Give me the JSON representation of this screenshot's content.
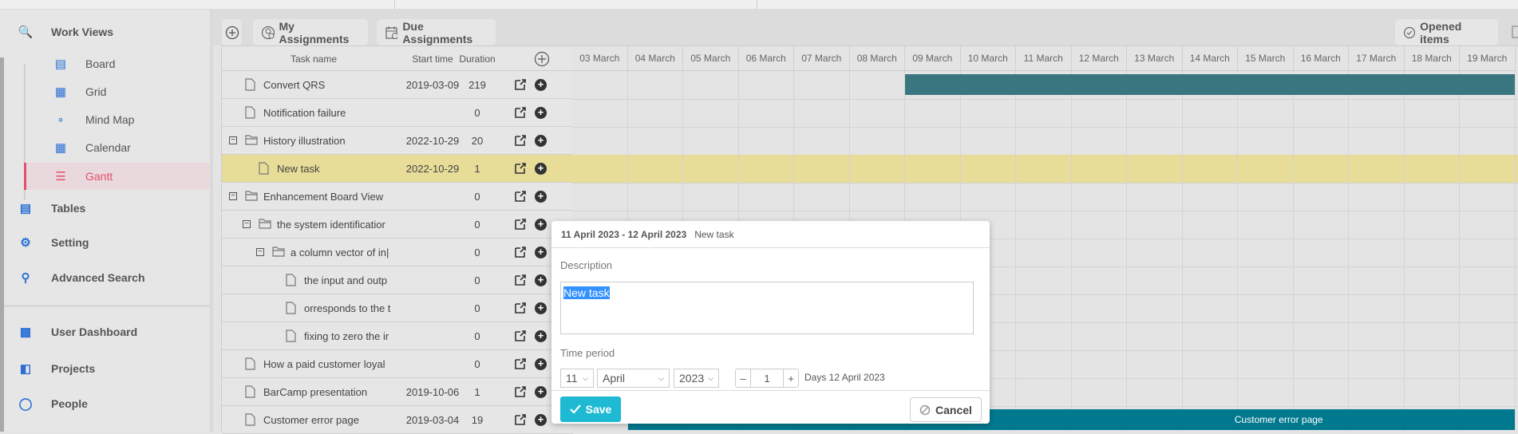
{
  "sidebar": {
    "work_views": "Work Views",
    "sub_items": [
      {
        "label": "Board",
        "icon": "board-icon"
      },
      {
        "label": "Grid",
        "icon": "grid-icon"
      },
      {
        "label": "Mind Map",
        "icon": "mind-map-icon"
      },
      {
        "label": "Calendar",
        "icon": "calendar-icon"
      },
      {
        "label": "Gantt",
        "icon": "gantt-icon",
        "active": true
      }
    ],
    "items": [
      {
        "label": "Tables",
        "icon": "table-icon"
      },
      {
        "label": "Setting",
        "icon": "gear-icon"
      },
      {
        "label": "Advanced Search",
        "icon": "search-icon"
      }
    ],
    "bottom_items": [
      {
        "label": "User Dashboard",
        "icon": "dashboard-icon"
      },
      {
        "label": "Projects",
        "icon": "book-icon"
      },
      {
        "label": "People",
        "icon": "person-icon"
      }
    ],
    "accent": "#e0506e",
    "icon_color": "#2b6fd6"
  },
  "toolbar": {
    "my_assignments": "My Assignments",
    "due_assignments": "Due Assignments",
    "opened_items": "Opened items"
  },
  "grid": {
    "columns": [
      "Task name",
      "Start time",
      "Duration"
    ],
    "rows": [
      {
        "name": "Convert QRS",
        "start": "2019-03-09",
        "duration": "219",
        "level": 0,
        "folder": false
      },
      {
        "name": "Notification failure",
        "start": "",
        "duration": "0",
        "level": 0,
        "folder": false
      },
      {
        "name": "History illustration",
        "start": "2022-10-29",
        "duration": "20",
        "level": 0,
        "folder": true
      },
      {
        "name": "New task",
        "start": "2022-10-29",
        "duration": "1",
        "level": 1,
        "folder": false,
        "selected": true
      },
      {
        "name": "Enhancement Board View",
        "start": "",
        "duration": "0",
        "level": 0,
        "folder": true
      },
      {
        "name": "the system identificatior",
        "start": "",
        "duration": "0",
        "level": 1,
        "folder": true
      },
      {
        "name": "a column vector of in|",
        "start": "",
        "duration": "0",
        "level": 2,
        "folder": true
      },
      {
        "name": "the input and outp",
        "start": "",
        "duration": "0",
        "level": 3,
        "folder": false
      },
      {
        "name": "orresponds to the t",
        "start": "",
        "duration": "0",
        "level": 3,
        "folder": false
      },
      {
        "name": "fixing to zero the ir",
        "start": "",
        "duration": "0",
        "level": 3,
        "folder": false
      },
      {
        "name": "How a paid customer loyal",
        "start": "",
        "duration": "0",
        "level": 0,
        "folder": false
      },
      {
        "name": "BarCamp presentation",
        "start": "2019-10-06",
        "duration": "1",
        "level": 0,
        "folder": false
      },
      {
        "name": "Customer error page",
        "start": "2019-03-04",
        "duration": "19",
        "level": 0,
        "folder": false
      }
    ]
  },
  "timeline": {
    "dates": [
      "03 March",
      "04 March",
      "05 March",
      "06 March",
      "07 March",
      "08 March",
      "09 March",
      "10 March",
      "11 March",
      "12 March",
      "13 March",
      "14 March",
      "15 March",
      "16 March",
      "17 March",
      "18 March",
      "19 March"
    ],
    "bars": [
      {
        "row": 0,
        "start": "09 March",
        "label": "",
        "color": "#3a7680"
      },
      {
        "row": 12,
        "start": "04 March",
        "label": "Customer error page",
        "color": "#00798f"
      }
    ],
    "selected_row_color": "#e7dc98"
  },
  "popup": {
    "range": "11 April 2023 - 12 April 2023",
    "task": "New task",
    "description_label": "Description",
    "description": "New task",
    "time_period_label": "Time period",
    "day": "11",
    "month": "April",
    "year": "2023",
    "duration": "1",
    "minus": "–",
    "plus": "+",
    "days_text": "Days 12 April 2023",
    "save": "Save",
    "cancel": "Cancel",
    "save_color": "#1ebad3"
  }
}
